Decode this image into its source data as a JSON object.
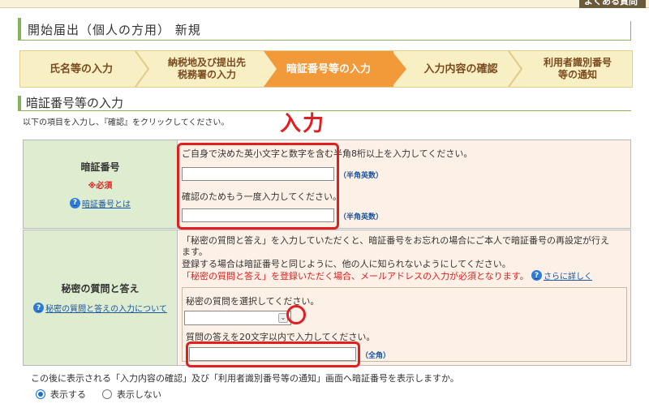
{
  "header": {
    "faq_label": "よくある質問"
  },
  "page": {
    "title": "開始届出（個人の方用） 新規"
  },
  "steps": [
    {
      "label": "氏名等の入力"
    },
    {
      "label_line1": "納税地及び提出先",
      "label_line2": "税務署の入力"
    },
    {
      "label": "暗証番号等の入力"
    },
    {
      "label": "入力内容の確認"
    },
    {
      "label_line1": "利用者識別番号",
      "label_line2": "等の通知"
    }
  ],
  "section": {
    "title": "暗証番号等の入力",
    "instruction": "以下の項目を入力し、『確認』をクリックしてください。"
  },
  "annotation": {
    "text": "入力"
  },
  "pin": {
    "label": "暗証番号",
    "required": "※必須",
    "help_link": "暗証番号とは",
    "desc": "ご自身で決めた英小文字と数字を含む半角8桁以上を入力してください。",
    "confirm_desc": "確認のためもう一度入力してください。",
    "hint": "（半角英数）",
    "value1": "",
    "value2": ""
  },
  "secret": {
    "label": "秘密の質問と答え",
    "help_link": "秘密の質問と答えの入力について",
    "desc_line1": "「秘密の質問と答え」を入力していただくと、暗証番号をお忘れの場合にご本人で暗証番号の再設定が行え",
    "desc_line2": "ます。",
    "desc_line3": "登録する場合は暗証番号と同じように、他の人に知られないようにしてください。",
    "desc_red": "「秘密の質問と答え」を登録いただく場合、メールアドレスの入力が必須となります。",
    "more_link": "さらに詳しく",
    "select_prompt": "秘密の質問を選択してください。",
    "select_value": "",
    "answer_prompt": "質問の答えを20文字以内で入力してください。",
    "answer_hint": "（全角）",
    "answer_value": ""
  },
  "footer": {
    "question": "この後に表示される「入力内容の確認」及び「利用者識別番号等の通知」画面へ暗証番号を表示しますか。",
    "option_show": "表示する",
    "option_hide": "表示しない"
  },
  "colors": {
    "accent_green": "#8ab25a",
    "active_step": "#f29a3a",
    "annotation_red": "#e02020",
    "link_blue": "#1a55a0"
  }
}
